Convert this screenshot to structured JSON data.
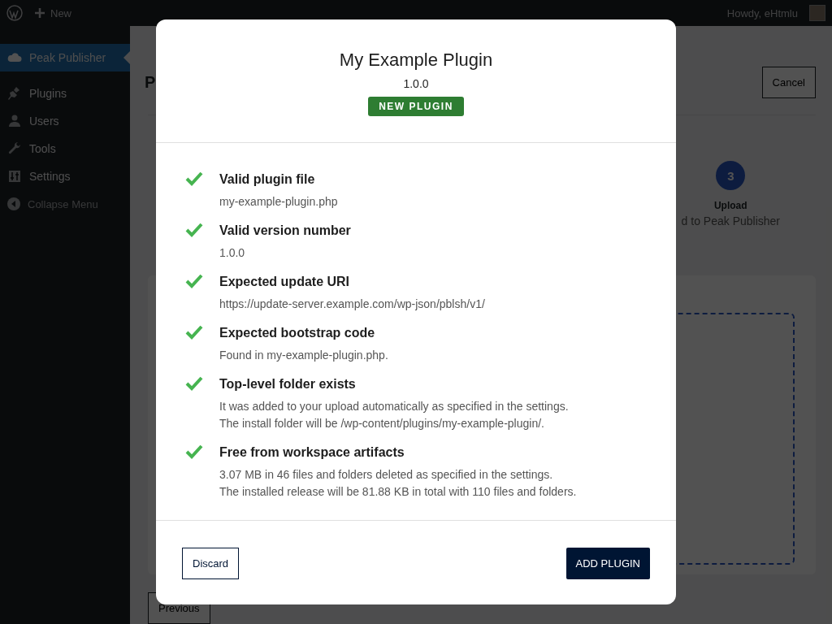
{
  "admin_bar": {
    "new_label": "New",
    "greeting": "Howdy, eHtmlu"
  },
  "sidebar": {
    "items": [
      {
        "label": "Peak Publisher",
        "selected": true
      },
      {
        "label": "Plugins",
        "selected": false
      },
      {
        "label": "Users",
        "selected": false
      },
      {
        "label": "Tools",
        "selected": false
      },
      {
        "label": "Settings",
        "selected": false
      }
    ],
    "collapse_label": "Collapse Menu"
  },
  "page": {
    "heading": "P",
    "cancel_button": "Cancel",
    "step": {
      "number": "3",
      "title": "Upload",
      "caption": "d to Peak Publisher"
    },
    "previous_button": "Previous"
  },
  "modal": {
    "title": "My Example Plugin",
    "version": "1.0.0",
    "badge": "NEW PLUGIN",
    "checks": [
      {
        "title": "Valid plugin file",
        "lines": [
          "my-example-plugin.php"
        ]
      },
      {
        "title": "Valid version number",
        "lines": [
          "1.0.0"
        ]
      },
      {
        "title": "Expected update URI",
        "lines": [
          "https://update-server.example.com/wp-json/pblsh/v1/"
        ]
      },
      {
        "title": "Expected bootstrap code",
        "lines": [
          "Found in my-example-plugin.php."
        ]
      },
      {
        "title": "Top-level folder exists",
        "lines": [
          "It was added to your upload automatically as specified in the settings.",
          "The install folder will be /wp-content/plugins/my-example-plugin/."
        ]
      },
      {
        "title": "Free from workspace artifacts",
        "lines": [
          "3.07 MB in 46 files and folders deleted as specified in the settings.",
          "The installed release will be 81.88 KB in total with 110 files and folders."
        ]
      }
    ],
    "discard_button": "Discard",
    "add_button": "ADD PLUGIN"
  }
}
